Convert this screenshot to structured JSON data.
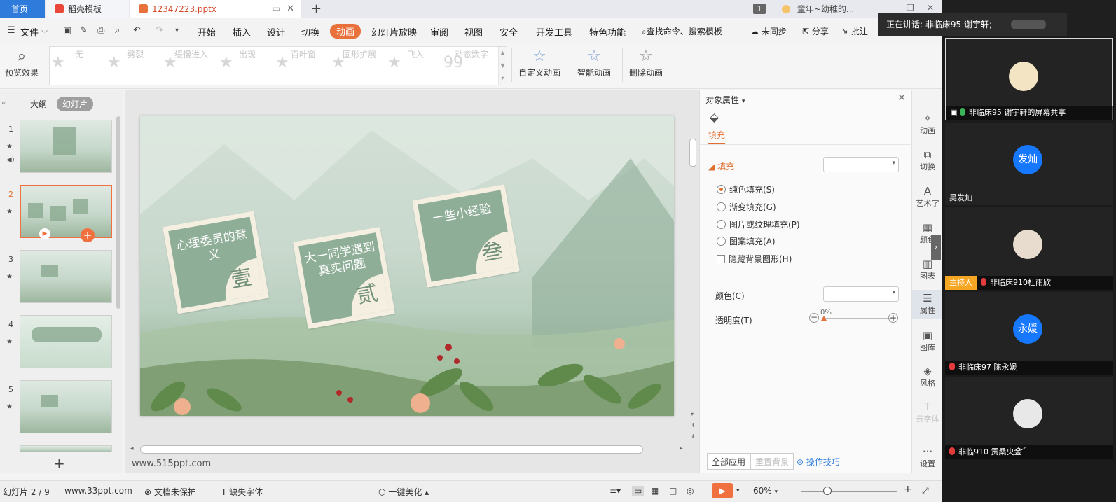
{
  "title_tabs": {
    "home": "首页",
    "template_tab": "稻壳模板",
    "doc_tab": "12347223.pptx",
    "new_tab": "+",
    "window_count": "1",
    "other_window": "童年~幼稚的..."
  },
  "menu": {
    "file": "文件",
    "items": [
      "开始",
      "插入",
      "设计",
      "切换",
      "动画",
      "幻灯片放映",
      "审阅",
      "视图",
      "安全",
      "开发工具",
      "特色功能"
    ],
    "active": "动画",
    "search": "查找命令、搜索模板",
    "sync": "未同步",
    "share": "分享",
    "comment": "批注"
  },
  "ribbon": {
    "preview": "预览效果",
    "animations": [
      "无",
      "劈裂",
      "缓慢进入",
      "出现",
      "百叶窗",
      "圆形扩展",
      "飞入",
      "动态数字"
    ],
    "custom_anim": "自定义动画",
    "smart_anim": "智能动画",
    "delete_anim": "删除动画"
  },
  "left_panel": {
    "tab_outline": "大纲",
    "tab_slides": "幻灯片",
    "slide_numbers": [
      "1",
      "2",
      "3",
      "4",
      "5"
    ]
  },
  "slide": {
    "stamps": [
      {
        "title": "心理委员的意义",
        "num": "壹"
      },
      {
        "title": "大一同学遇到真实问题",
        "num": "贰"
      },
      {
        "title": "一些小经验",
        "num": "叁"
      }
    ]
  },
  "notes": "www.515ppt.com",
  "props": {
    "header": "对象属性",
    "tab_fill": "填充",
    "section_fill": "填充",
    "options": [
      "纯色填充(S)",
      "渐变填充(G)",
      "图片或纹理填充(P)",
      "图案填充(A)"
    ],
    "hide_bg": "隐藏背景图形(H)",
    "color_label": "颜色(C)",
    "transparency_label": "透明度(T)",
    "transparency_value": "0%",
    "apply_all": "全部应用",
    "reset_bg": "重置背景",
    "tips": "操作技巧"
  },
  "sidebar": [
    "动画",
    "切换",
    "艺术字",
    "颜色",
    "图表",
    "属性",
    "图库",
    "风格",
    "云字体",
    "设置"
  ],
  "status": {
    "slide_pos": "幻灯片 2 / 9",
    "site": "www.33ppt.com",
    "protect": "文档未保护",
    "missing_font": "缺失字体",
    "beautify": "一键美化",
    "zoom": "60%"
  },
  "meeting": {
    "speaking": "正在讲话: 非临床95 谢宇轩;",
    "tiles": [
      {
        "label": "非临床95 谢宇轩的屏幕共享",
        "avatar_text": "",
        "avatar_color": "#f3e5c4",
        "host": false,
        "mic": "green"
      },
      {
        "label": "吴发灿",
        "avatar_text": "发灿",
        "avatar_color": "#1677ff",
        "host": false,
        "mic": "none"
      },
      {
        "label": "非临床910杜雨欣",
        "avatar_text": "",
        "avatar_color": "#e7dccd",
        "host": true,
        "mic": "muted"
      },
      {
        "label": "非临床97 陈永媛",
        "avatar_text": "永媛",
        "avatar_color": "#1677ff",
        "host": false,
        "mic": "muted"
      },
      {
        "label": "非临910 贡桑央金",
        "avatar_text": "",
        "avatar_color": "#e8e8e8",
        "host": false,
        "mic": "muted"
      }
    ],
    "host_badge": "主持人"
  },
  "colors": {
    "accent": "#e8713c",
    "brand_blue": "#2f7bdc",
    "stamp_green": "#8fae97"
  }
}
